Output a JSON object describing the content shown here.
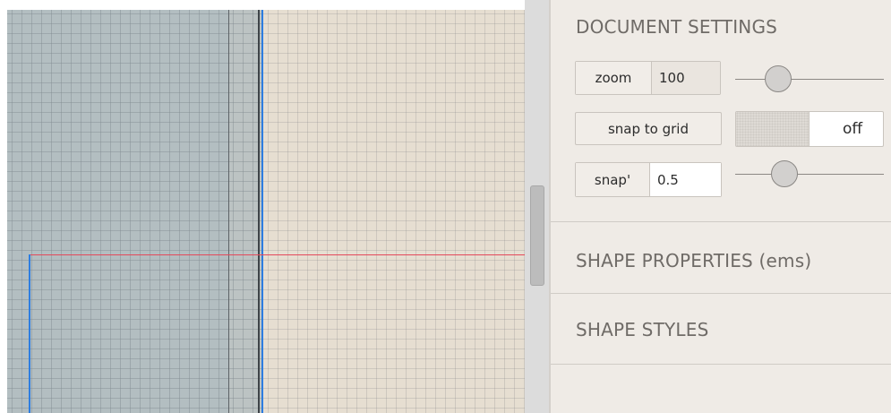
{
  "panel": {
    "document_settings": {
      "heading": "DOCUMENT SETTINGS",
      "zoom": {
        "label": "zoom",
        "value": "100",
        "slider_fraction": 0.29
      },
      "snap_to_grid": {
        "label": "snap to grid",
        "toggle_state": "off"
      },
      "snap_step": {
        "label": "snap'",
        "value": "0.5",
        "slider_fraction": 0.33
      }
    },
    "shape_properties": {
      "heading": "SHAPE PROPERTIES (ems)"
    },
    "shape_styles": {
      "heading": "SHAPE STYLES"
    }
  },
  "colors": {
    "guide_red": "#e4495b",
    "guide_blue": "#2d7de0",
    "canvas_bg": "#e6ded1",
    "canvas_outside": "#b3bec1",
    "panel_bg": "#efebe6"
  }
}
